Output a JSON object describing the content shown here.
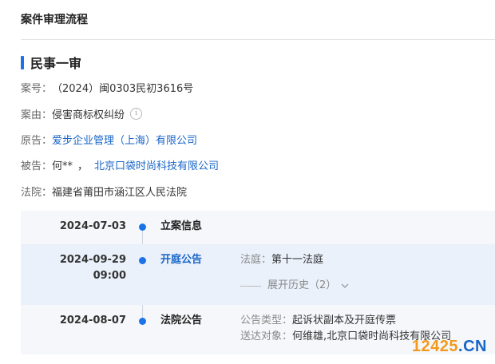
{
  "header": {
    "title": "案件审理流程"
  },
  "case": {
    "section_title": "民事一审",
    "case_no_label": "案号：",
    "case_no_value": "（2024）闽0303民初3616号",
    "cause_label": "案由：",
    "cause_value": "侵害商标权纠纷",
    "plaintiff_label": "原告：",
    "plaintiff_value": "爱步企业管理（上海）有限公司",
    "defendant_label": "被告：",
    "defendant_person": "何**",
    "defendant_sep": "，",
    "defendant_company": "北京口袋时尚科技有限公司",
    "court_label": "法院：",
    "court_value": "福建省莆田市涵江区人民法院"
  },
  "timeline": [
    {
      "date": "2024-07-03",
      "time": "",
      "event": "立案信息"
    },
    {
      "date": "2024-09-29",
      "time": "09:00",
      "event": "开庭公告",
      "detail_label": "法庭：",
      "detail_value": "第十一法庭",
      "expand_label": "展开历史（2）"
    },
    {
      "date": "2024-08-07",
      "time": "",
      "event": "法院公告",
      "detail1_label": "公告类型：",
      "detail1_value": "起诉状副本及开庭传票",
      "detail2_label": "送达对象：",
      "detail2_value": "何维雄,北京口袋时尚科技有限公司"
    }
  ],
  "watermark": {
    "number": "12425",
    "domain": ".CN"
  },
  "colors": {
    "accent": "#1a73e8",
    "link": "#1a66c8",
    "watermark_orange": "#f39a1c"
  }
}
